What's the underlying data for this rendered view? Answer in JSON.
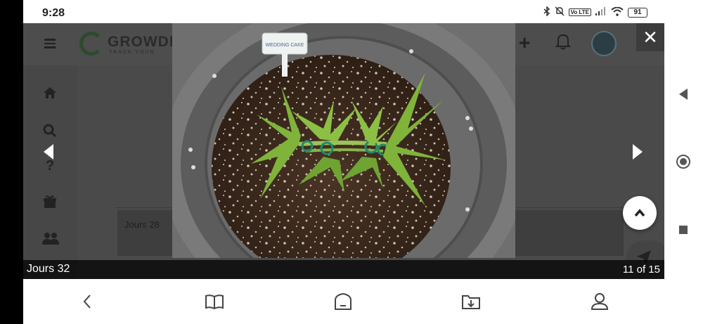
{
  "status_bar": {
    "time": "9:28",
    "volte": "Vo LTE",
    "battery": "91"
  },
  "site": {
    "logo_text": "GROWDIA",
    "logo_tagline": "TRACK YOUR",
    "card_label": "Jours 28"
  },
  "lightbox": {
    "caption": "Jours 32",
    "counter": "11 of 15",
    "close_label": "✕",
    "plant_tag_text": "WEDDING CAKE"
  },
  "icons": {
    "menu": "hamburger-icon",
    "add": "plus-icon",
    "notifications": "bell-icon",
    "home": "home-icon",
    "search": "search-icon",
    "help": "question-icon",
    "gift": "gift-icon",
    "community": "users-icon",
    "prev": "triangle-left-icon",
    "next": "triangle-right-icon",
    "scroll_top": "chevron-up-icon",
    "back": "chevron-left-icon",
    "bookmarks": "book-icon",
    "home_browser": "home-outline-icon",
    "downloads": "download-folder-icon",
    "account": "person-icon"
  },
  "colors": {
    "overlay": "#4a4a4a",
    "caption_bg": "#000000",
    "brand_green": "#2d4a2d"
  }
}
